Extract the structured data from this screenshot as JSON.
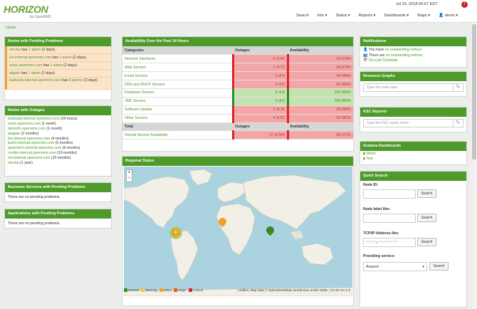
{
  "brand": {
    "name": "HORIZON",
    "sub": "by OpenNMS"
  },
  "clock": "Jul 22, 2018 05:57 EDT",
  "alarm_badge": "&",
  "nav": {
    "search": "Search",
    "info": "Info ▾",
    "status": "Status ▾",
    "reports": "Reports ▾",
    "dashboards": "Dashboards ▾",
    "maps": "Maps ▾",
    "user": "demo ▾"
  },
  "breadcrumb": "Home",
  "pending": {
    "title": "Nodes with Pending Problems",
    "rows": [
      {
        "node": "mecha",
        "has": " has ",
        "alarm": "1 alarm",
        "age": " (2 days)"
      },
      {
        "node": "ise.internal.opennms.com",
        "has": " has ",
        "alarm": "1 alarm",
        "age": " (2 days)"
      },
      {
        "node": "sonic.opennms.com",
        "has": " has ",
        "alarm": "1 alarm",
        "age": " (2 days)"
      },
      {
        "node": "aligato",
        "has": " has ",
        "alarm": "1 alarm",
        "age": " (2 days)"
      },
      {
        "node": "barbrady.internal.opennms.com",
        "has": " has ",
        "alarm": "3 alarms",
        "age": " (3 days)"
      }
    ]
  },
  "outages": {
    "title": "Nodes with Outages",
    "rows": [
      {
        "node": "barbrady.internal.opennms.com",
        "age": " (24 hours)"
      },
      {
        "node": "sonic.opennms.com",
        "age": " (1 week)"
      },
      {
        "node": "demo01.opennms.com",
        "age": " (1 month)"
      },
      {
        "node": "abigate",
        "age": " (2 months)"
      },
      {
        "node": "lee.internal.opennms.com",
        "age": " (4 months)"
      },
      {
        "node": "ipa01.internal.opennms.com",
        "age": " (5 months)"
      },
      {
        "node": "apache01.internal.opennms.com",
        "age": " (6 months)"
      },
      {
        "node": "ricoble.internal.opennms.com",
        "age": " (10 months)"
      },
      {
        "node": "nst.internal.opennms.com",
        "age": " (10 months)"
      },
      {
        "node": "mecha",
        "age": " (1 year)"
      }
    ]
  },
  "biz": {
    "title": "Business Services with Pending Problems",
    "text": "There are no pending problems."
  },
  "apps": {
    "title": "Applications with Pending Problems",
    "text": "There are no pending problems."
  },
  "avail": {
    "title": "Availability Over the Past 24 Hours",
    "headers": [
      "Categories",
      "Outages",
      "Availability"
    ],
    "rows": [
      {
        "cat": "Network Interfaces",
        "out": "6 of 84",
        "av": "93.579%",
        "state": "red"
      },
      {
        "cat": "Web Servers",
        "out": "7 of 71",
        "av": "94.372%",
        "state": "red"
      },
      {
        "cat": "Email Servers",
        "out": "2 of 4",
        "av": "49.999%",
        "state": "red"
      },
      {
        "cat": "DNS and DHCP Servers",
        "out": "2 of 5",
        "av": "80.000%",
        "state": "red"
      },
      {
        "cat": "Database Servers",
        "out": "0 of 8",
        "av": "100.000%",
        "state": "green"
      },
      {
        "cat": "JMX Servers",
        "out": "0 of 6",
        "av": "100.000%",
        "state": "green"
      },
      {
        "cat": "Software Update",
        "out": "2 of 18",
        "av": "93.395%",
        "state": "red"
      },
      {
        "cat": "Other Servers",
        "out": "4 of 51",
        "av": "92.961%",
        "state": "red"
      }
    ],
    "total": {
      "label": "Total",
      "out": "Outages",
      "av": "Availability"
    },
    "overall": {
      "label": "Overall Service Availability",
      "out": "27 of 285",
      "av": "96.172%"
    }
  },
  "regional": {
    "title": "Regional Status",
    "legend": [
      {
        "label": "Normal",
        "color": "#3a8a1a"
      },
      {
        "label": "Warning",
        "color": "#f3d12a"
      },
      {
        "label": "Minor",
        "color": "#f3a02a"
      },
      {
        "label": "Major",
        "color": "#e06020"
      },
      {
        "label": "Critical",
        "color": "#d02a2a"
      }
    ],
    "attribution": "Leaflet | Map data © OpenStreetMap contributors under ODbL, CC BY-SA 2.0",
    "cluster_label": "8"
  },
  "notifications": {
    "title": "Notifications",
    "rows": [
      {
        "pre": "You have ",
        "link": "no outstanding notices"
      },
      {
        "pre": "There are ",
        "link": "no outstanding notices"
      },
      {
        "pre": "",
        "link": "On-Call Schedule"
      }
    ]
  },
  "resource": {
    "title": "Resource Graphs",
    "placeholder": "Type the node label"
  },
  "ksc": {
    "title": "KSC Reports",
    "placeholder": "Type the KSC report name"
  },
  "grafana": {
    "title": "Grafana Dashboards",
    "items": [
      "Demo",
      "Test"
    ]
  },
  "quick": {
    "title": "Quick Search",
    "node_id": "Node ID:",
    "node_label": "Node label like:",
    "tcpip": "TCP/IP Address like:",
    "tcpip_placeholder": "*.*.*.* or *:*:*:*:*:*:*:*",
    "service": "Providing service:",
    "service_value": "Amazon",
    "search": "Search"
  }
}
